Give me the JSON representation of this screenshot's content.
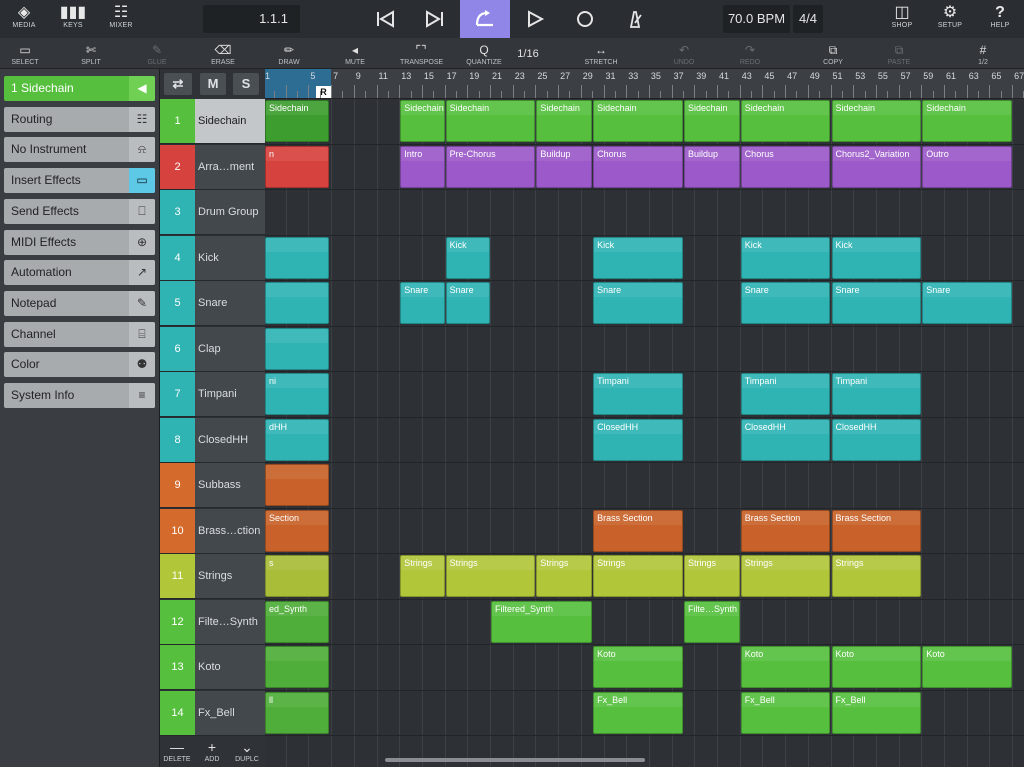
{
  "topbar": {
    "media": "MEDIA",
    "keys": "KEYS",
    "mixer": "MIXER",
    "position": "1.1.1",
    "tempo": "70.0 BPM",
    "signature": "4/4",
    "shop": "SHOP",
    "setup": "SETUP",
    "help": "HELP"
  },
  "toolbar": {
    "select": "SELECT",
    "split": "SPLIT",
    "glue": "GLUE",
    "erase": "ERASE",
    "draw": "DRAW",
    "mute": "MUTE",
    "transpose": "TRANSPOSE",
    "quantize": "QUANTIZE",
    "quantize_value": "1/16",
    "stretch": "STRETCH",
    "undo": "UNDO",
    "redo": "REDO",
    "copy": "COPY",
    "paste": "PASTE",
    "snap_value": "1/2"
  },
  "inspector": {
    "items": [
      {
        "label": "1  Sidechain",
        "icon": "arrow-left-icon"
      },
      {
        "label": "Routing",
        "icon": "routing-icon"
      },
      {
        "label": "No Instrument",
        "icon": "bell-icon"
      },
      {
        "label": "Insert Effects",
        "icon": "insert-icon"
      },
      {
        "label": "Send Effects",
        "icon": "send-icon"
      },
      {
        "label": "MIDI Effects",
        "icon": "midi-fx-icon"
      },
      {
        "label": "Automation",
        "icon": "automation-icon"
      },
      {
        "label": "Notepad",
        "icon": "notepad-icon"
      },
      {
        "label": "Channel",
        "icon": "channel-icon"
      },
      {
        "label": "Color",
        "icon": "color-icon"
      },
      {
        "label": "System Info",
        "icon": "menu-icon"
      }
    ]
  },
  "track_header": {
    "mute": "M",
    "solo": "S"
  },
  "tracks": [
    {
      "num": "1",
      "name": "Sidechain",
      "color": "#56c03e"
    },
    {
      "num": "2",
      "name": "Arra…ment",
      "color": "#d6423d"
    },
    {
      "num": "3",
      "name": "Drum Group",
      "color": "#2fb3b3"
    },
    {
      "num": "4",
      "name": "Kick",
      "color": "#2fb3b3"
    },
    {
      "num": "5",
      "name": "Snare",
      "color": "#2fb3b3"
    },
    {
      "num": "6",
      "name": "Clap",
      "color": "#2fb3b3"
    },
    {
      "num": "7",
      "name": "Timpani",
      "color": "#2fb3b3"
    },
    {
      "num": "8",
      "name": "ClosedHH",
      "color": "#2fb3b3"
    },
    {
      "num": "9",
      "name": "Subbass",
      "color": "#d46a2c"
    },
    {
      "num": "10",
      "name": "Brass…ction",
      "color": "#d46a2c"
    },
    {
      "num": "11",
      "name": "Strings",
      "color": "#b2c63a"
    },
    {
      "num": "12",
      "name": "Filte…Synth",
      "color": "#56c03e"
    },
    {
      "num": "13",
      "name": "Koto",
      "color": "#56c03e"
    },
    {
      "num": "14",
      "name": "Fx_Bell",
      "color": "#56c03e"
    }
  ],
  "bottom": {
    "delete": "DELETE",
    "add": "ADD",
    "duplicate": "DUPLC"
  },
  "ruler": {
    "loop_marker": "R",
    "bars": [
      "1",
      "5",
      "7",
      "9",
      "11",
      "13",
      "15",
      "17",
      "19",
      "21",
      "23",
      "25",
      "27",
      "29",
      "31",
      "33",
      "35",
      "37",
      "39",
      "41",
      "43",
      "45",
      "47",
      "49",
      "51",
      "53",
      "55",
      "57",
      "59",
      "61",
      "63",
      "65",
      "67"
    ]
  },
  "clips": [
    {
      "track": 1,
      "start": 1,
      "len": 8,
      "label": "Sidechain",
      "color": "#3d9e2f",
      "partial": true
    },
    {
      "track": 1,
      "start": 13,
      "len": 4,
      "label": "Sidechain",
      "color": "#56c03e"
    },
    {
      "track": 1,
      "start": 17,
      "len": 8,
      "label": "Sidechain",
      "color": "#56c03e"
    },
    {
      "track": 1,
      "start": 25,
      "len": 5,
      "label": "Sidechain",
      "color": "#56c03e"
    },
    {
      "track": 1,
      "start": 30,
      "len": 8,
      "label": "Sidechain",
      "color": "#56c03e"
    },
    {
      "track": 1,
      "start": 38,
      "len": 5,
      "label": "Sidechain",
      "color": "#56c03e"
    },
    {
      "track": 1,
      "start": 43,
      "len": 8,
      "label": "Sidechain",
      "color": "#56c03e"
    },
    {
      "track": 1,
      "start": 51,
      "len": 8,
      "label": "Sidechain",
      "color": "#56c03e"
    },
    {
      "track": 1,
      "start": 59,
      "len": 8,
      "label": "Sidechain",
      "color": "#56c03e"
    },
    {
      "track": 2,
      "start": 1,
      "len": 6,
      "label": "n",
      "color": "#d6423d"
    },
    {
      "track": 2,
      "start": 13,
      "len": 4,
      "label": "Intro",
      "color": "#9b59c9"
    },
    {
      "track": 2,
      "start": 17,
      "len": 8,
      "label": "Pre-Chorus",
      "color": "#9b59c9"
    },
    {
      "track": 2,
      "start": 25,
      "len": 5,
      "label": "Buildup",
      "color": "#9b59c9"
    },
    {
      "track": 2,
      "start": 30,
      "len": 8,
      "label": "Chorus",
      "color": "#9b59c9"
    },
    {
      "track": 2,
      "start": 38,
      "len": 5,
      "label": "Buildup",
      "color": "#9b59c9"
    },
    {
      "track": 2,
      "start": 43,
      "len": 8,
      "label": "Chorus",
      "color": "#9b59c9"
    },
    {
      "track": 2,
      "start": 51,
      "len": 8,
      "label": "Chorus2_Variation",
      "color": "#9b59c9"
    },
    {
      "track": 2,
      "start": 59,
      "len": 8,
      "label": "Outro",
      "color": "#9b59c9"
    },
    {
      "track": 4,
      "start": 1,
      "len": 6,
      "label": "",
      "color": "#2fb3b3"
    },
    {
      "track": 4,
      "start": 17,
      "len": 4,
      "label": "Kick",
      "color": "#2fb3b3"
    },
    {
      "track": 4,
      "start": 30,
      "len": 8,
      "label": "Kick",
      "color": "#2fb3b3"
    },
    {
      "track": 4,
      "start": 43,
      "len": 8,
      "label": "Kick",
      "color": "#2fb3b3"
    },
    {
      "track": 4,
      "start": 51,
      "len": 8,
      "label": "Kick",
      "color": "#2fb3b3"
    },
    {
      "track": 5,
      "start": 1,
      "len": 6,
      "label": "",
      "color": "#2fb3b3"
    },
    {
      "track": 5,
      "start": 13,
      "len": 4,
      "label": "Snare",
      "color": "#2fb3b3"
    },
    {
      "track": 5,
      "start": 17,
      "len": 4,
      "label": "Snare",
      "color": "#2fb3b3"
    },
    {
      "track": 5,
      "start": 30,
      "len": 8,
      "label": "Snare",
      "color": "#2fb3b3"
    },
    {
      "track": 5,
      "start": 43,
      "len": 8,
      "label": "Snare",
      "color": "#2fb3b3"
    },
    {
      "track": 5,
      "start": 51,
      "len": 8,
      "label": "Snare",
      "color": "#2fb3b3"
    },
    {
      "track": 5,
      "start": 59,
      "len": 8,
      "label": "Snare",
      "color": "#2fb3b3"
    },
    {
      "track": 6,
      "start": 1,
      "len": 6,
      "label": "",
      "color": "#2fb3b3"
    },
    {
      "track": 7,
      "start": 1,
      "len": 6,
      "label": "ni",
      "color": "#2fb3b3"
    },
    {
      "track": 7,
      "start": 30,
      "len": 8,
      "label": "Timpani",
      "color": "#2fb3b3"
    },
    {
      "track": 7,
      "start": 43,
      "len": 8,
      "label": "Timpani",
      "color": "#2fb3b3"
    },
    {
      "track": 7,
      "start": 51,
      "len": 8,
      "label": "Timpani",
      "color": "#2fb3b3"
    },
    {
      "track": 8,
      "start": 1,
      "len": 6,
      "label": "dHH",
      "color": "#2fb3b3"
    },
    {
      "track": 8,
      "start": 30,
      "len": 8,
      "label": "ClosedHH",
      "color": "#2fb3b3"
    },
    {
      "track": 8,
      "start": 43,
      "len": 8,
      "label": "ClosedHH",
      "color": "#2fb3b3"
    },
    {
      "track": 8,
      "start": 51,
      "len": 8,
      "label": "ClosedHH",
      "color": "#2fb3b3"
    },
    {
      "track": 9,
      "start": 1,
      "len": 6,
      "label": "",
      "color": "#c8622a"
    },
    {
      "track": 10,
      "start": 1,
      "len": 6,
      "label": "Section",
      "color": "#c8622a"
    },
    {
      "track": 10,
      "start": 30,
      "len": 8,
      "label": "Brass Section",
      "color": "#c8622a"
    },
    {
      "track": 10,
      "start": 43,
      "len": 8,
      "label": "Brass Section",
      "color": "#c8622a"
    },
    {
      "track": 10,
      "start": 51,
      "len": 8,
      "label": "Brass Section",
      "color": "#c8622a"
    },
    {
      "track": 11,
      "start": 1,
      "len": 6,
      "label": "s",
      "color": "#a9bd38"
    },
    {
      "track": 11,
      "start": 13,
      "len": 4,
      "label": "Strings",
      "color": "#b2c63a"
    },
    {
      "track": 11,
      "start": 17,
      "len": 8,
      "label": "Strings",
      "color": "#b2c63a"
    },
    {
      "track": 11,
      "start": 25,
      "len": 5,
      "label": "Strings",
      "color": "#b2c63a"
    },
    {
      "track": 11,
      "start": 30,
      "len": 8,
      "label": "Strings",
      "color": "#b2c63a"
    },
    {
      "track": 11,
      "start": 38,
      "len": 5,
      "label": "Strings",
      "color": "#b2c63a"
    },
    {
      "track": 11,
      "start": 43,
      "len": 8,
      "label": "Strings",
      "color": "#b2c63a"
    },
    {
      "track": 11,
      "start": 51,
      "len": 8,
      "label": "Strings",
      "color": "#b2c63a"
    },
    {
      "track": 12,
      "start": 1,
      "len": 6,
      "label": "ed_Synth",
      "color": "#4fae39"
    },
    {
      "track": 12,
      "start": 21,
      "len": 9,
      "label": "Filtered_Synth",
      "color": "#56c03e"
    },
    {
      "track": 12,
      "start": 38,
      "len": 5,
      "label": "Filte…Synth",
      "color": "#56c03e"
    },
    {
      "track": 13,
      "start": 1,
      "len": 6,
      "label": "",
      "color": "#4fae39"
    },
    {
      "track": 13,
      "start": 30,
      "len": 8,
      "label": "Koto",
      "color": "#56c03e"
    },
    {
      "track": 13,
      "start": 43,
      "len": 8,
      "label": "Koto",
      "color": "#56c03e"
    },
    {
      "track": 13,
      "start": 51,
      "len": 8,
      "label": "Koto",
      "color": "#56c03e"
    },
    {
      "track": 13,
      "start": 59,
      "len": 8,
      "label": "Koto",
      "color": "#56c03e"
    },
    {
      "track": 14,
      "start": 1,
      "len": 6,
      "label": "ll",
      "color": "#4fae39"
    },
    {
      "track": 14,
      "start": 30,
      "len": 8,
      "label": "Fx_Bell",
      "color": "#56c03e"
    },
    {
      "track": 14,
      "start": 43,
      "len": 8,
      "label": "Fx_Bell",
      "color": "#56c03e"
    },
    {
      "track": 14,
      "start": 51,
      "len": 8,
      "label": "Fx_Bell",
      "color": "#56c03e"
    }
  ]
}
